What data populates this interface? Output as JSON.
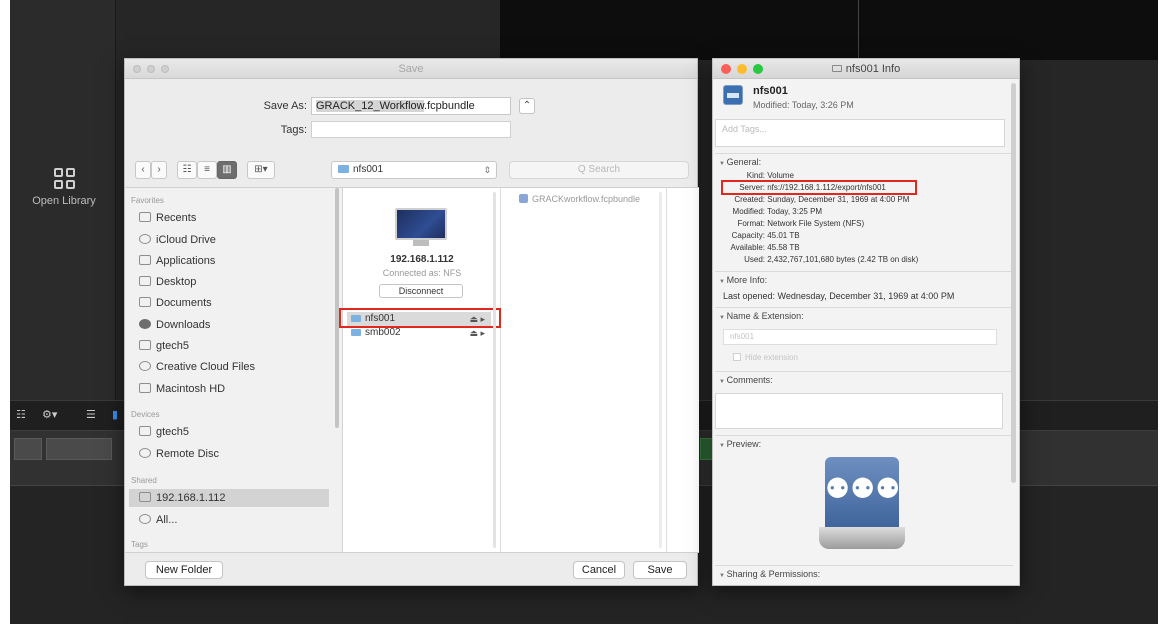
{
  "app": {
    "open_library_label": "Open Library",
    "tool_icons": [
      "list-icon",
      "gear-icon",
      "filmstrip-icon"
    ]
  },
  "save_dialog": {
    "title": "Save",
    "save_as_label": "Save As:",
    "save_as_value_selected": "GRACK_12_Workflow",
    "save_as_value_ext": ".fcpbundle",
    "tags_label": "Tags:",
    "toolbar": {
      "back": "‹",
      "forward": "›",
      "view_icon": "☷",
      "view_list": "≡",
      "view_columns": "▥",
      "view_gallery": "⊞▾",
      "path_value": "nfs001",
      "search_placeholder": "Q Search"
    },
    "sidebar": {
      "favorites_header": "Favorites",
      "favorites": [
        {
          "label": "Recents",
          "icon": "clock-icon"
        },
        {
          "label": "iCloud Drive",
          "icon": "cloud-icon"
        },
        {
          "label": "Applications",
          "icon": "applications-icon"
        },
        {
          "label": "Desktop",
          "icon": "desktop-icon"
        },
        {
          "label": "Documents",
          "icon": "document-icon"
        },
        {
          "label": "Downloads",
          "icon": "download-icon"
        },
        {
          "label": "gtech5",
          "icon": "home-icon"
        },
        {
          "label": "Creative Cloud Files",
          "icon": "creative-cloud-icon"
        },
        {
          "label": "Macintosh HD",
          "icon": "hard-drive-icon"
        }
      ],
      "devices_header": "Devices",
      "devices": [
        {
          "label": "gtech5",
          "icon": "external-drive-icon"
        },
        {
          "label": "Remote Disc",
          "icon": "disc-icon"
        }
      ],
      "shared_header": "Shared",
      "shared": [
        {
          "label": "192.168.1.112",
          "icon": "server-icon"
        },
        {
          "label": "All...",
          "icon": "network-icon"
        }
      ],
      "tags_header": "Tags"
    },
    "server_column": {
      "server_name": "192.168.1.112",
      "connected_as": "Connected as: NFS",
      "disconnect_label": "Disconnect",
      "shares": [
        {
          "label": "nfs001",
          "eject": "⏏ ▸",
          "selected": true
        },
        {
          "label": "smb002",
          "eject": "⏏ ▸",
          "selected": false
        }
      ]
    },
    "contents_column": {
      "item": "GRACKworkflow.fcpbundle"
    },
    "new_folder_label": "New Folder",
    "cancel_label": "Cancel",
    "save_label": "Save"
  },
  "info_panel": {
    "title": "nfs001 Info",
    "name": "nfs001",
    "modified_header": "Modified: Today, 3:26 PM",
    "tags_placeholder": "Add Tags...",
    "general_header": "General:",
    "general": {
      "kind_key": "Kind:",
      "kind": "Volume",
      "server_key": "Server:",
      "server": "nfs://192.168.1.112/export/nfs001",
      "created_key": "Created:",
      "created": "Sunday, December 31, 1969 at 4:00 PM",
      "modified_key": "Modified:",
      "modified": "Today, 3:25 PM",
      "format_key": "Format:",
      "format": "Network File System (NFS)",
      "capacity_key": "Capacity:",
      "capacity": "45.01 TB",
      "available_key": "Available:",
      "available": "45.58 TB",
      "used_key": "Used:",
      "used": "2,432,767,101,680 bytes (2.42 TB on disk)"
    },
    "more_info_header": "More Info:",
    "last_opened": "Last opened: Wednesday, December 31, 1969 at 4:00 PM",
    "name_ext_header": "Name & Extension:",
    "name_field": "nfs001",
    "hide_extension": "Hide extension",
    "comments_header": "Comments:",
    "preview_header": "Preview:",
    "sharing_header": "Sharing & Permissions:"
  },
  "colors": {
    "highlight": "#e0281e",
    "traffic_red": "#fc5f57",
    "traffic_yellow": "#fdbc2e",
    "traffic_green": "#28c840"
  }
}
